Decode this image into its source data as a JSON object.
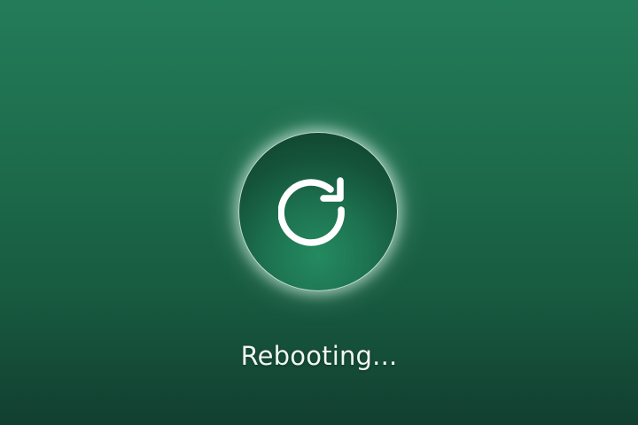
{
  "status": {
    "text": "Rebooting..."
  },
  "badge": {
    "icon": "refresh-icon"
  },
  "colors": {
    "background_top": "#237c59",
    "background_bottom": "#123f30",
    "badge_fill": "#1d7250",
    "icon": "#ffffff",
    "text": "#f1f6f3"
  }
}
